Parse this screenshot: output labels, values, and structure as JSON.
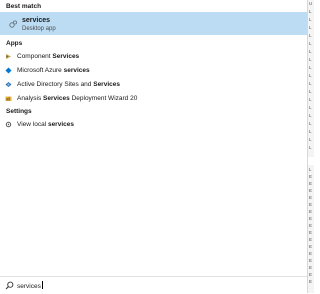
{
  "sections": {
    "best_match": "Best match",
    "apps": "Apps",
    "settings": "Settings"
  },
  "best_match_item": {
    "title": "services",
    "subtitle": "Desktop app",
    "icon": "services-gear-icon"
  },
  "apps": [
    {
      "pre": "Component ",
      "bold": "Services",
      "post": "",
      "icon": "component-services-icon"
    },
    {
      "pre": "Microsoft Azure ",
      "bold": "services",
      "post": "",
      "icon": "azure-services-icon"
    },
    {
      "pre": "Active Directory Sites and ",
      "bold": "Services",
      "post": "",
      "icon": "active-directory-icon"
    },
    {
      "pre": "Analysis ",
      "bold": "Services",
      "post": " Deployment Wizard 20",
      "icon": "analysis-services-icon"
    }
  ],
  "settings_items": [
    {
      "pre": "View local ",
      "bold": "services",
      "post": "",
      "icon": "settings-gear-icon"
    }
  ],
  "search": {
    "value": "services",
    "icon": "search-icon"
  },
  "colors": {
    "highlight": "#bcdcf4",
    "azure_blue": "#0078d4"
  }
}
